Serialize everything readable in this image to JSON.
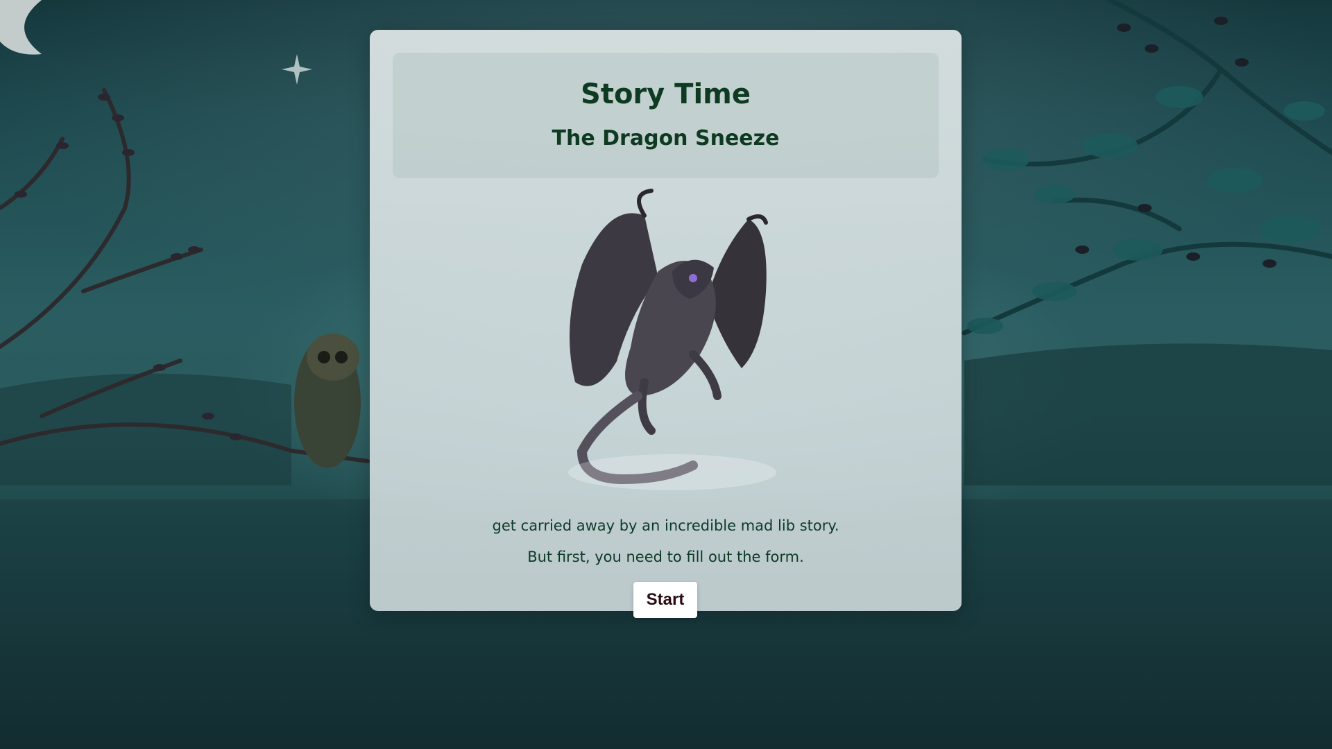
{
  "page": {
    "title": "Story Time",
    "story_title": "The Dragon Sneeze",
    "intro_text": "get carried away by an incredible mad lib story.",
    "instruction_text": "But first, you need to fill out the form.",
    "start_label": "Start"
  },
  "illustration": {
    "icon": "dragon-illustration"
  },
  "colors": {
    "heading": "#0f3a22",
    "body_text": "#0d3a26",
    "button_text": "#2a0d14",
    "card_bg": "#dde6e7",
    "background": "#1f4c51"
  }
}
